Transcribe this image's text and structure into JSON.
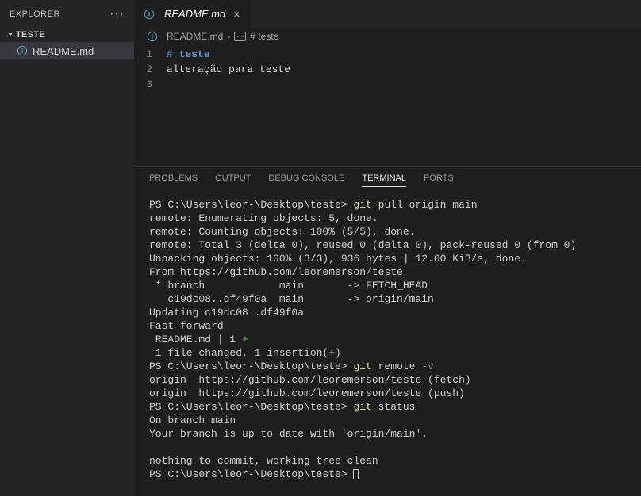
{
  "sidebar": {
    "title": "EXPLORER",
    "folder": "TESTE",
    "file": "README.md"
  },
  "tab": {
    "label": "README.md"
  },
  "breadcrumb": {
    "file": "README.md",
    "section": "# teste"
  },
  "editor": {
    "lines": [
      "1",
      "2",
      "3"
    ],
    "h1mark": "#",
    "h1text": "teste",
    "line2": "alteração para teste"
  },
  "panel": {
    "tabs": {
      "problems": "PROBLEMS",
      "output": "OUTPUT",
      "debug": "DEBUG CONSOLE",
      "terminal": "TERMINAL",
      "ports": "PORTS"
    }
  },
  "terminal": {
    "prompt": "PS C:\\Users\\leor-\\Desktop\\teste>",
    "git": "git",
    "cmd_pull": "pull origin main",
    "l2": "remote: Enumerating objects: 5, done.",
    "l3": "remote: Counting objects: 100% (5/5), done.",
    "l4": "remote: Total 3 (delta 0), reused 0 (delta 0), pack-reused 0 (from 0)",
    "l5": "Unpacking objects: 100% (3/3), 936 bytes | 12.00 KiB/s, done.",
    "l6": "From https://github.com/leoremerson/teste",
    "l7": " * branch            main       -> FETCH_HEAD",
    "l8": "   c19dc08..df49f0a  main       -> origin/main",
    "l9": "Updating c19dc08..df49f0a",
    "l10": "Fast-forward",
    "l11a": " README.md | 1 ",
    "l11b": "+",
    "l12": " 1 file changed, 1 insertion(+)",
    "cmd_remote": "remote ",
    "flag_v": "-v",
    "l14": "origin  https://github.com/leoremerson/teste (fetch)",
    "l15": "origin  https://github.com/leoremerson/teste (push)",
    "cmd_status": "status",
    "l17": "On branch main",
    "l18": "Your branch is up to date with 'origin/main'.",
    "l19": "",
    "l20": "nothing to commit, working tree clean"
  }
}
